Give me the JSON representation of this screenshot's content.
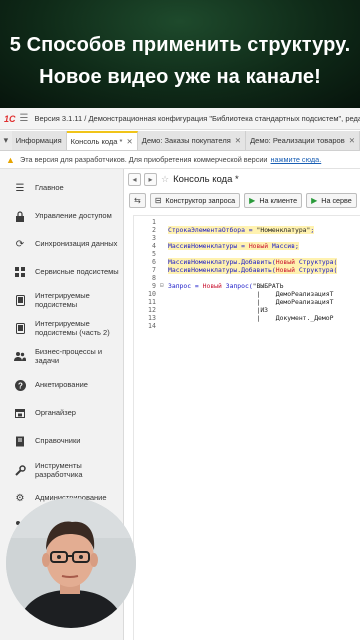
{
  "banner": {
    "line1": "5 Способов применить структуру.",
    "line2": "Новое видео уже на канале!"
  },
  "titlebar": {
    "logo": "1С",
    "title": "Версия 3.1.11 / Демонстрационная конфигурация \"Библиотека стандартных подсистем\", редакция 3.1"
  },
  "tabs": [
    {
      "label": "Информация",
      "active": false
    },
    {
      "label": "Консоль кода *",
      "active": true
    },
    {
      "label": "Демо: Заказы покупателя",
      "active": false
    },
    {
      "label": "Демо: Реализации товаров",
      "active": false
    }
  ],
  "warning": {
    "text": "Эта версия для разработчиков. Для приобретения коммерческой версии",
    "link": "нажмите сюда."
  },
  "sidebar": {
    "items": [
      {
        "label": "Главное",
        "icon": "hamburger-icon"
      },
      {
        "label": "Управление доступом",
        "icon": "lock-icon"
      },
      {
        "label": "Синхронизация данных",
        "icon": "sync-icon"
      },
      {
        "label": "Сервисные подсистемы",
        "icon": "grid-icon"
      },
      {
        "label": "Интегрируемые подсистемы",
        "icon": "tablet-icon"
      },
      {
        "label": "Интегрируемые подсистемы (часть 2)",
        "icon": "tablet-icon"
      },
      {
        "label": "Бизнес-процессы и задачи",
        "icon": "people-icon"
      },
      {
        "label": "Анкетирование",
        "icon": "question-icon"
      },
      {
        "label": "Органайзер",
        "icon": "calendar-icon"
      },
      {
        "label": "Справочники",
        "icon": "book-icon"
      },
      {
        "label": "Инструменты разработчика",
        "icon": "wrench-icon"
      },
      {
        "label": "Администрирование",
        "icon": "gear-icon"
      },
      {
        "label": "",
        "icon": "people-icon"
      },
      {
        "label": "",
        "icon": "chart-icon"
      }
    ]
  },
  "main": {
    "title": "Консоль кода *",
    "toolbar": {
      "constructor": "Конструктор запроса",
      "on_client": "На клиенте",
      "on_server": "На серве"
    }
  },
  "editor": {
    "line_numbers": [
      "1",
      "2",
      "3",
      "4",
      "5",
      "6",
      "7",
      "8",
      "9",
      "10",
      "11",
      "12",
      "13",
      "14"
    ]
  },
  "colors": {
    "accent": "#f0c419",
    "keyword": "#c8102e",
    "identifier": "#1a1ac8",
    "highlight": "#fff2b0"
  }
}
